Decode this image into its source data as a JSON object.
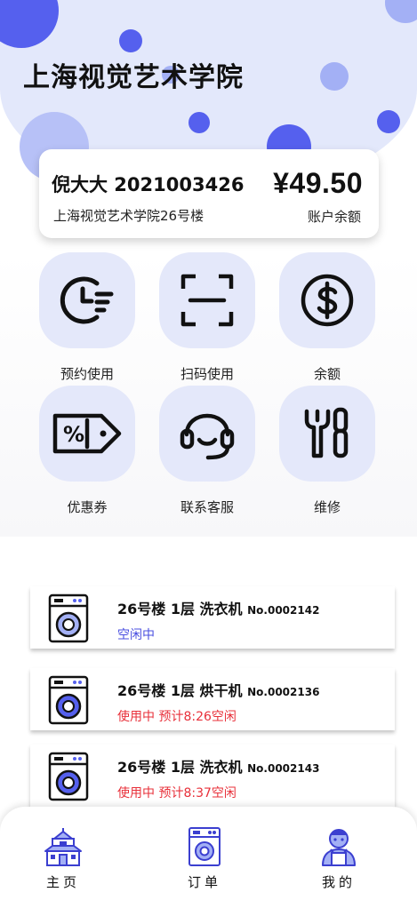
{
  "header": {
    "school_title": "上海视觉艺术学院"
  },
  "account": {
    "name_id": "倪大大 2021003426",
    "balance": "¥49.50",
    "address": "上海视觉艺术学院26号楼",
    "balance_label": "账户余额"
  },
  "actions": [
    {
      "label": "预约使用",
      "icon": "clock-icon"
    },
    {
      "label": "扫码使用",
      "icon": "scan-icon"
    },
    {
      "label": "余额",
      "icon": "dollar-icon"
    },
    {
      "label": "优惠券",
      "icon": "coupon-icon"
    },
    {
      "label": "联系客服",
      "icon": "headset-icon"
    },
    {
      "label": "维修",
      "icon": "tools-icon"
    }
  ],
  "machines": [
    {
      "title": "26号楼 1层 洗衣机",
      "number": "No.0002142",
      "status": "空闲中",
      "status_color": "#4a4fe0"
    },
    {
      "title": "26号楼 1层 烘干机",
      "number": "No.0002136",
      "status": "使用中 预计8:26空闲",
      "status_color": "#e8303a"
    },
    {
      "title": "26号楼 1层 洗衣机",
      "number": "No.0002143",
      "status": "使用中 预计8:37空闲",
      "status_color": "#e8303a"
    }
  ],
  "tabs": [
    {
      "label": "主页",
      "icon": "home-building-icon"
    },
    {
      "label": "订单",
      "icon": "washer-icon"
    },
    {
      "label": "我的",
      "icon": "user-avatar-icon"
    }
  ],
  "colors": {
    "accent": "#5560ee",
    "light_accent": "#e4e8fa",
    "idle": "#4a4fe0",
    "busy": "#e8303a"
  }
}
